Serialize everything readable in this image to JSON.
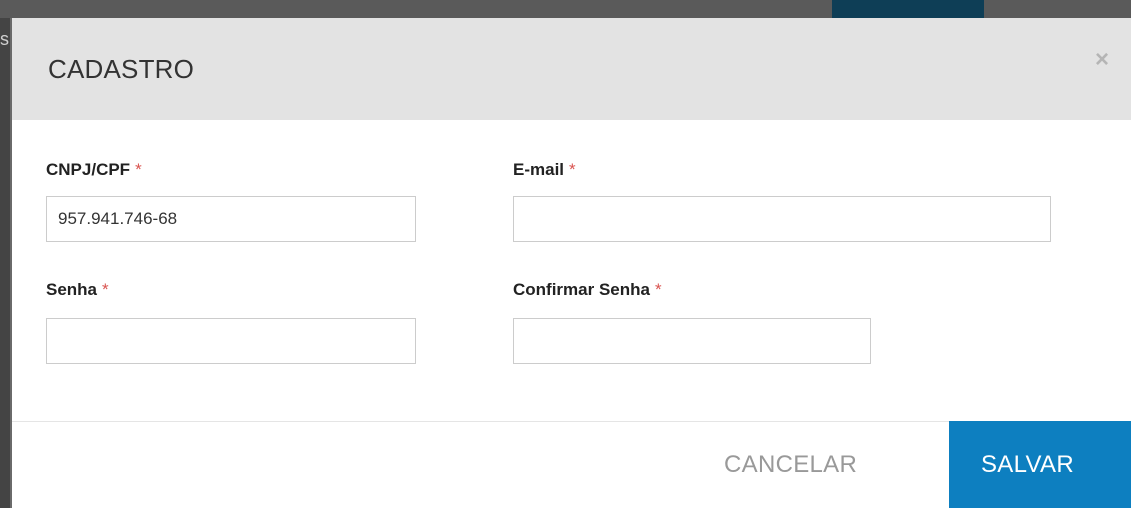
{
  "backdrop": {
    "glyph": "s"
  },
  "modal": {
    "title": "CADASTRO",
    "close_glyph": "×"
  },
  "form": {
    "required_mark": "*",
    "cnpj": {
      "label": "CNPJ/CPF",
      "value": "957.941.746-68",
      "placeholder": ""
    },
    "email": {
      "label": "E-mail",
      "value": "",
      "placeholder": ""
    },
    "senha": {
      "label": "Senha",
      "value": "",
      "placeholder": ""
    },
    "confirmar_senha": {
      "label": "Confirmar Senha",
      "value": "",
      "placeholder": ""
    }
  },
  "footer": {
    "cancel_label": "CANCELAR",
    "save_label": "SALVAR"
  },
  "colors": {
    "accent": "#0d7fc0",
    "required": "#d9534f",
    "header_bg": "#e3e3e3"
  }
}
